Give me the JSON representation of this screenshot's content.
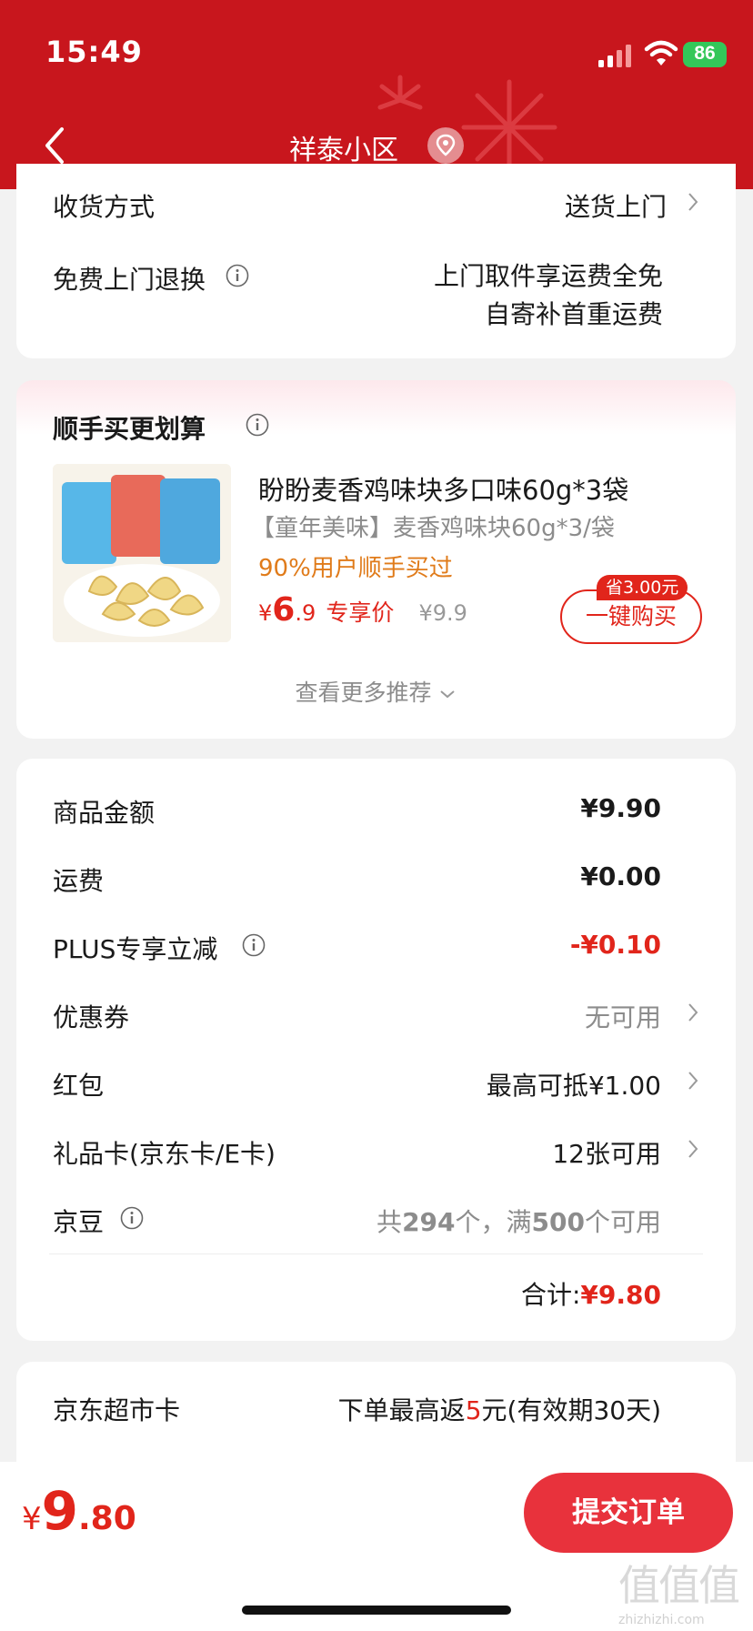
{
  "status_bar": {
    "time": "15:49",
    "battery": "86"
  },
  "header": {
    "title": "祥泰小区"
  },
  "delivery": {
    "method_label": "收货方式",
    "method_value": "送货上门",
    "return_label": "免费上门退换",
    "return_line1": "上门取件享运费全免",
    "return_line2": "自寄补首重运费"
  },
  "addon": {
    "title": "顺手买更划算",
    "product_name": "盼盼麦香鸡味块多口味60g*3袋",
    "product_desc": "【童年美味】麦香鸡味块60g*3/袋",
    "social_proof": "90%用户顺手买过",
    "price_symbol": "¥",
    "price_int": "6",
    "price_dec": ".9",
    "price_tag": "专享价",
    "original_price": "¥9.9",
    "save_badge": "省3.00元",
    "buy_button": "一键购买",
    "more": "查看更多推荐"
  },
  "summary": {
    "rows": [
      {
        "label": "商品金额",
        "value": "¥9.90"
      },
      {
        "label": "运费",
        "value": "¥0.00"
      },
      {
        "label": "PLUS专享立减",
        "value": "-¥0.10"
      },
      {
        "label": "优惠券",
        "value": "无可用"
      },
      {
        "label": "红包",
        "value": "最高可抵¥1.00"
      },
      {
        "label": "礼品卡(京东卡/E卡)",
        "value": "12张可用"
      },
      {
        "label": "京豆",
        "value_pre": "共",
        "value_n1": "294",
        "value_mid": "个，满",
        "value_n2": "500",
        "value_post": "个可用"
      }
    ],
    "total_label": "合计:",
    "total_value": "¥9.80"
  },
  "supermarket": {
    "label": "京东超市卡",
    "value_pre": "下单最高返",
    "value_num": "5",
    "value_post": "元(有效期30天)"
  },
  "bottom": {
    "price_symbol": "¥",
    "price_int": "9",
    "price_dec": ".80",
    "submit": "提交订单",
    "watermark": "值",
    "watermark_site": "zhizhizhi.com"
  },
  "colors": {
    "brand_red": "#c8161d",
    "price_red": "#e1251b",
    "accent_orange": "#e07b1a"
  },
  "icons": [
    "back-arrow-icon",
    "location-icon",
    "info-icon",
    "chevron-right-icon",
    "chevron-down-icon",
    "wifi-icon",
    "signal-icon",
    "battery-icon"
  ]
}
